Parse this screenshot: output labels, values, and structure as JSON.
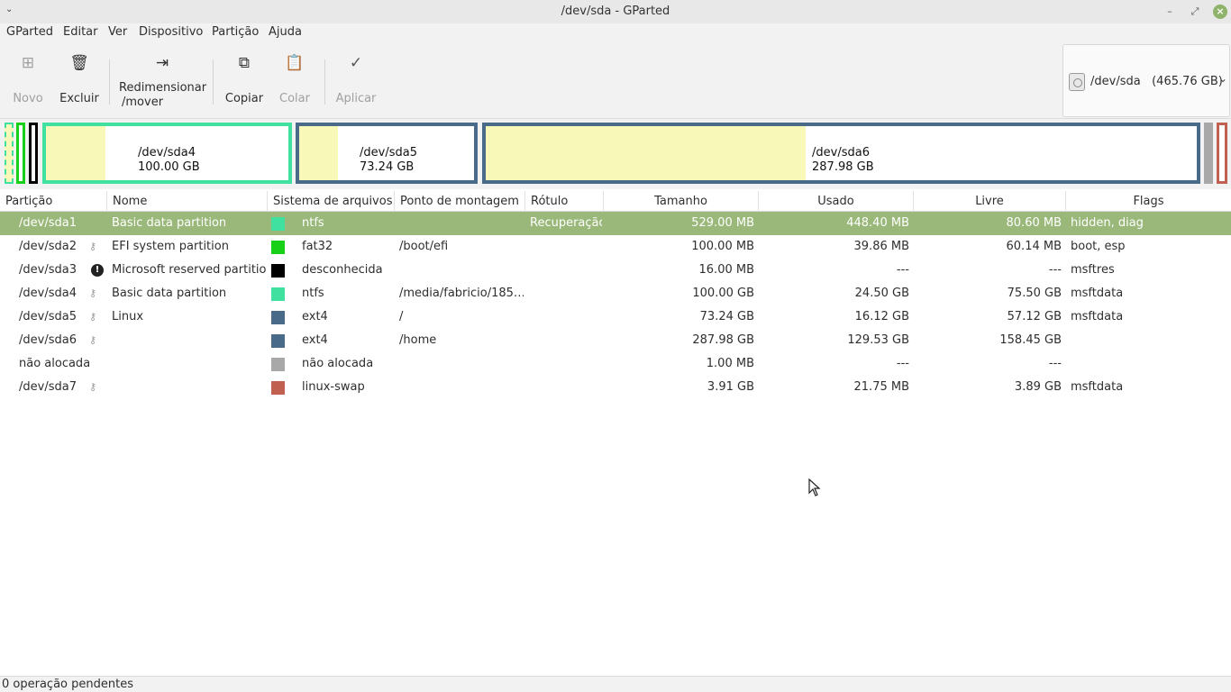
{
  "window": {
    "title": "/dev/sda - GParted"
  },
  "menu": [
    "GParted",
    "Editar",
    "Ver",
    "Dispositivo",
    "Partição",
    "Ajuda"
  ],
  "toolbar": {
    "new": "Novo",
    "delete": "Excluir",
    "resize_line1": "Redimensionar",
    "resize_line2": "/mover",
    "copy": "Copiar",
    "paste": "Colar",
    "apply": "Aplicar"
  },
  "device": {
    "name": "/dev/sda",
    "size": "(465.76 GB)"
  },
  "diskmap": [
    {
      "name": "/dev/sda4",
      "size": "100.00 GB",
      "color": "#40e0a0",
      "used_fraction": 0.245
    },
    {
      "name": "/dev/sda5",
      "size": "73.24 GB",
      "color": "#4a6a8a",
      "used_fraction": 0.22
    },
    {
      "name": "/dev/sda6",
      "size": "287.98 GB",
      "color": "#4a6a8a",
      "used_fraction": 0.45
    }
  ],
  "columns": [
    "Partição",
    "Nome",
    "Sistema de arquivos",
    "Ponto de montagem",
    "Rótulo",
    "Tamanho",
    "Usado",
    "Livre",
    "Flags"
  ],
  "rows": [
    {
      "partition": "/dev/sda1",
      "icon": "none",
      "name": "Basic data partition",
      "fs": "ntfs",
      "fs_color": "#40e0a0",
      "mount": "",
      "label": "Recuperação",
      "size": "529.00 MB",
      "used": "448.40 MB",
      "free": "80.60 MB",
      "flags": "hidden, diag"
    },
    {
      "partition": "/dev/sda2",
      "icon": "key",
      "name": "EFI system partition",
      "fs": "fat32",
      "fs_color": "#18d018",
      "mount": "/boot/efi",
      "label": "",
      "size": "100.00 MB",
      "used": "39.86 MB",
      "free": "60.14 MB",
      "flags": "boot, esp"
    },
    {
      "partition": "/dev/sda3",
      "icon": "warning",
      "name": "Microsoft reserved partition",
      "fs": "desconhecida",
      "fs_color": "#000000",
      "mount": "",
      "label": "",
      "size": "16.00 MB",
      "used": "---",
      "free": "---",
      "flags": "msftres"
    },
    {
      "partition": "/dev/sda4",
      "icon": "key",
      "name": "Basic data partition",
      "fs": "ntfs",
      "fs_color": "#40e0a0",
      "mount": "/media/fabricio/185…",
      "label": "",
      "size": "100.00 GB",
      "used": "24.50 GB",
      "free": "75.50 GB",
      "flags": "msftdata"
    },
    {
      "partition": "/dev/sda5",
      "icon": "key",
      "name": "Linux",
      "fs": "ext4",
      "fs_color": "#4a6a8a",
      "mount": "/",
      "label": "",
      "size": "73.24 GB",
      "used": "16.12 GB",
      "free": "57.12 GB",
      "flags": "msftdata"
    },
    {
      "partition": "/dev/sda6",
      "icon": "key",
      "name": "",
      "fs": "ext4",
      "fs_color": "#4a6a8a",
      "mount": "/home",
      "label": "",
      "size": "287.98 GB",
      "used": "129.53 GB",
      "free": "158.45 GB",
      "flags": ""
    },
    {
      "partition": "não alocada",
      "icon": "none",
      "name": "",
      "fs": "não alocada",
      "fs_color": "#a8a8a8",
      "mount": "",
      "label": "",
      "size": "1.00 MB",
      "used": "---",
      "free": "---",
      "flags": ""
    },
    {
      "partition": "/dev/sda7",
      "icon": "key",
      "name": "",
      "fs": "linux-swap",
      "fs_color": "#c06050",
      "mount": "",
      "label": "",
      "size": "3.91 GB",
      "used": "21.75 MB",
      "free": "3.89 GB",
      "flags": "msftdata"
    }
  ],
  "status": {
    "text": "0 operação pendentes"
  }
}
